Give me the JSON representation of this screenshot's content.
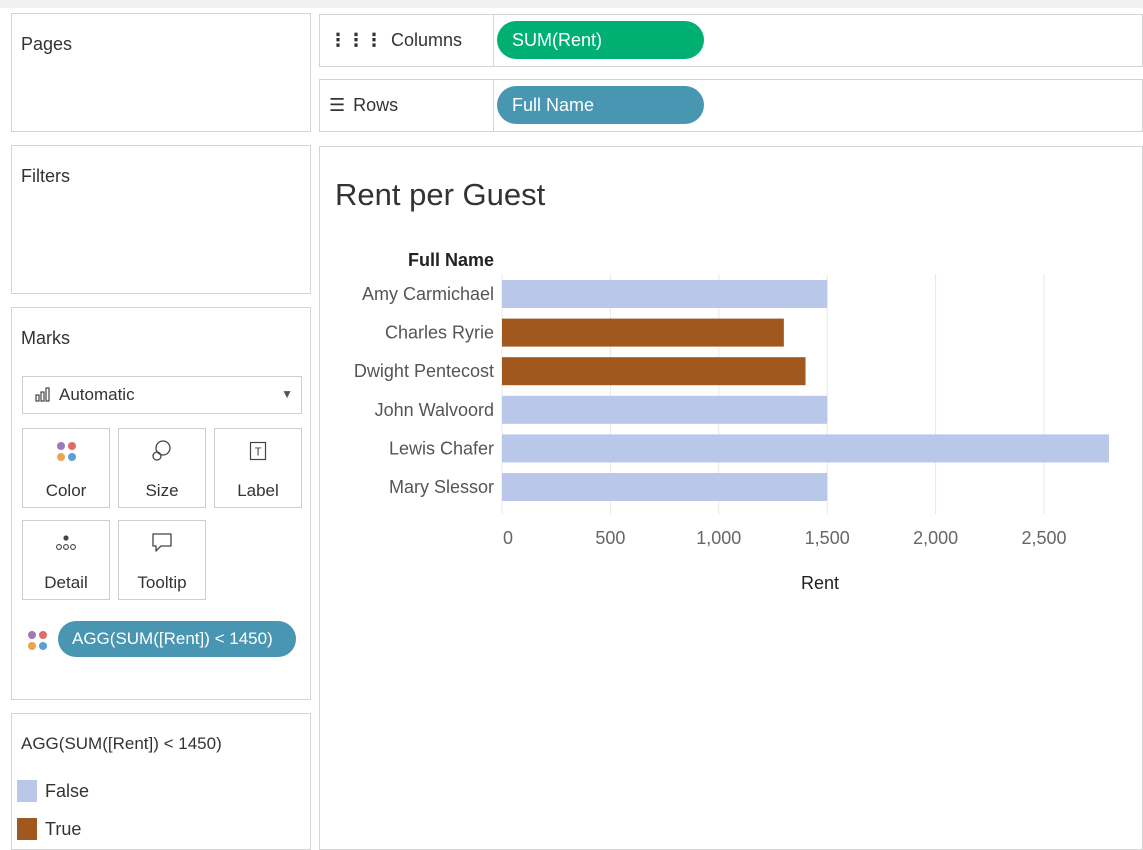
{
  "panels": {
    "pages_title": "Pages",
    "filters_title": "Filters",
    "marks_title": "Marks"
  },
  "shelves": {
    "columns_label": "Columns",
    "columns_pill": "SUM(Rent)",
    "rows_label": "Rows",
    "rows_pill": "Full Name"
  },
  "marks": {
    "mark_type": "Automatic",
    "buttons": [
      "Color",
      "Size",
      "Label",
      "Detail",
      "Tooltip"
    ],
    "color_field": "AGG(SUM([Rent]) < 1450)"
  },
  "legend": {
    "title": "AGG(SUM([Rent]) < 1450)",
    "items": [
      {
        "label": "False",
        "color": "#b9c7e8"
      },
      {
        "label": "True",
        "color": "#a0581e"
      }
    ]
  },
  "colors": {
    "columns_pill": "#00b073",
    "rows_pill": "#4996b2",
    "false": "#b9c7e8",
    "true": "#a0581e",
    "gridline": "#e8e8e8"
  },
  "view": {
    "title": "Rent per Guest"
  },
  "chart_data": {
    "type": "bar",
    "orientation": "horizontal",
    "title": "Rent per Guest",
    "row_header": "Full Name",
    "xlabel": "Rent",
    "categories": [
      "Amy Carmichael",
      "Charles Ryrie",
      "Dwight Pentecost",
      "John Walvoord",
      "Lewis Chafer",
      "Mary Slessor"
    ],
    "values": [
      1500,
      1300,
      1400,
      1500,
      2800,
      1500
    ],
    "color_flags": [
      "False",
      "True",
      "True",
      "False",
      "False",
      "False"
    ],
    "xticks": [
      "0",
      "500",
      "1,000",
      "1,500",
      "2,000",
      "2,500"
    ],
    "xtick_values": [
      0,
      500,
      1000,
      1500,
      2000,
      2500
    ],
    "xlim": [
      0,
      2850
    ],
    "grid": true
  }
}
